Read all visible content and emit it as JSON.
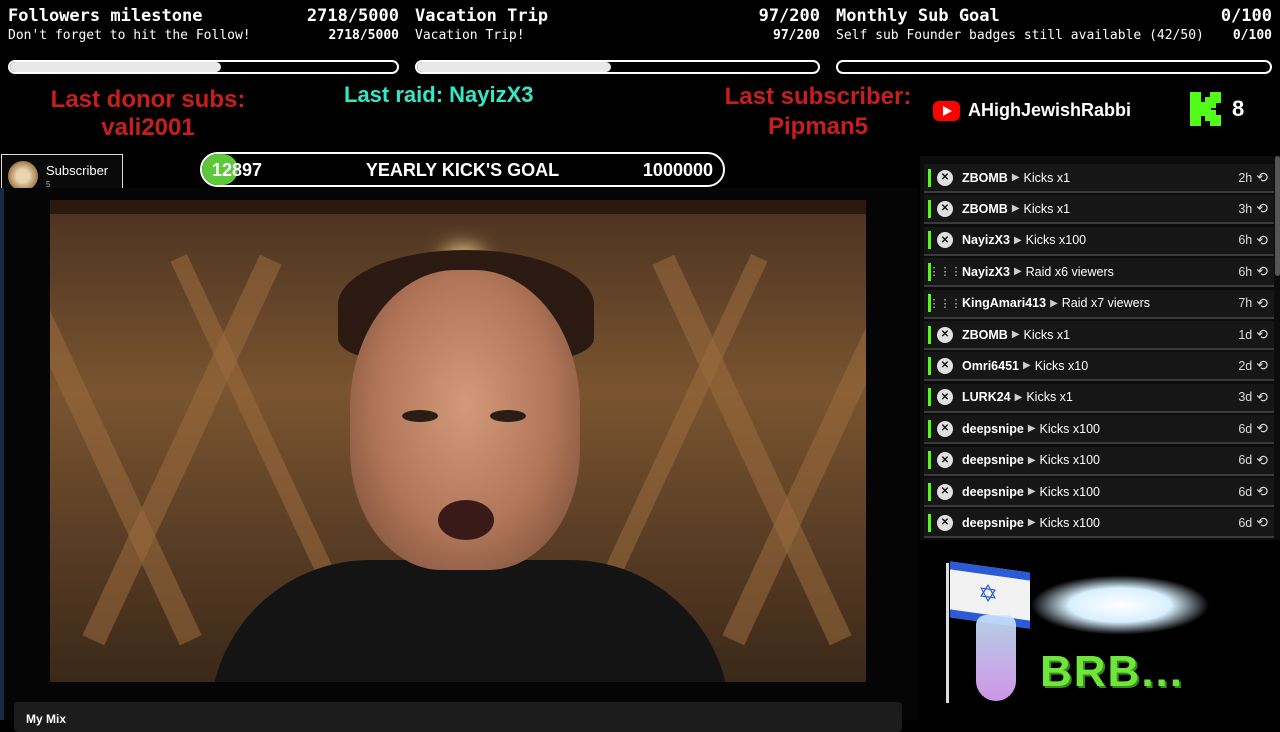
{
  "goals": [
    {
      "title": "Followers milestone",
      "title_value": "2718/5000",
      "subtitle": "Don't forget to hit the Follow!",
      "sub_value": "2718/5000",
      "progress": 0.544
    },
    {
      "title": "Vacation Trip",
      "title_value": "97/200",
      "subtitle": "Vacation Trip!",
      "sub_value": "97/200",
      "progress": 0.485
    },
    {
      "title": "Monthly Sub Goal",
      "title_value": "0/100",
      "subtitle": "Self sub Founder badges still available (42/50)",
      "sub_value": "0/100",
      "progress": 0.0
    }
  ],
  "labels": {
    "donor_title": "Last donor subs:",
    "donor_name": "vali2001",
    "raid": "Last raid: NayizX3",
    "sub_title": "Last subscriber:",
    "sub_name": "Pipman5"
  },
  "channel": {
    "youtube_name": "AHighJewishRabbi",
    "kick_count": "8"
  },
  "subscriber_badge": {
    "label": "Subscriber",
    "count": "5"
  },
  "kick_goal": {
    "current": "12897",
    "label": "YEARLY KICK'S GOAL",
    "target": "1000000",
    "progress": 0.0129
  },
  "events": [
    {
      "icon": "kick",
      "name": "ZBOMB",
      "action": "Kicks x1",
      "time": "2h"
    },
    {
      "icon": "kick",
      "name": "ZBOMB",
      "action": "Kicks x1",
      "time": "3h"
    },
    {
      "icon": "kick",
      "name": "NayizX3",
      "action": "Kicks x100",
      "time": "6h"
    },
    {
      "icon": "raid",
      "name": "NayizX3",
      "action": "Raid x6 viewers",
      "time": "6h"
    },
    {
      "icon": "raid",
      "name": "KingAmari413",
      "action": "Raid x7 viewers",
      "time": "7h"
    },
    {
      "icon": "kick",
      "name": "ZBOMB",
      "action": "Kicks x1",
      "time": "1d"
    },
    {
      "icon": "kick",
      "name": "Omri6451",
      "action": "Kicks x10",
      "time": "2d"
    },
    {
      "icon": "kick",
      "name": "LURK24",
      "action": "Kicks x1",
      "time": "3d"
    },
    {
      "icon": "kick",
      "name": "deepsnipe",
      "action": "Kicks x100",
      "time": "6d"
    },
    {
      "icon": "kick",
      "name": "deepsnipe",
      "action": "Kicks x100",
      "time": "6d"
    },
    {
      "icon": "kick",
      "name": "deepsnipe",
      "action": "Kicks x100",
      "time": "6d"
    },
    {
      "icon": "kick",
      "name": "deepsnipe",
      "action": "Kicks x100",
      "time": "6d"
    }
  ],
  "brb_text": "BRB...",
  "mix_label": "My Mix",
  "colors": {
    "kick_green": "#53fc18",
    "red": "#c71e1e",
    "cyan": "#36e6c4"
  }
}
